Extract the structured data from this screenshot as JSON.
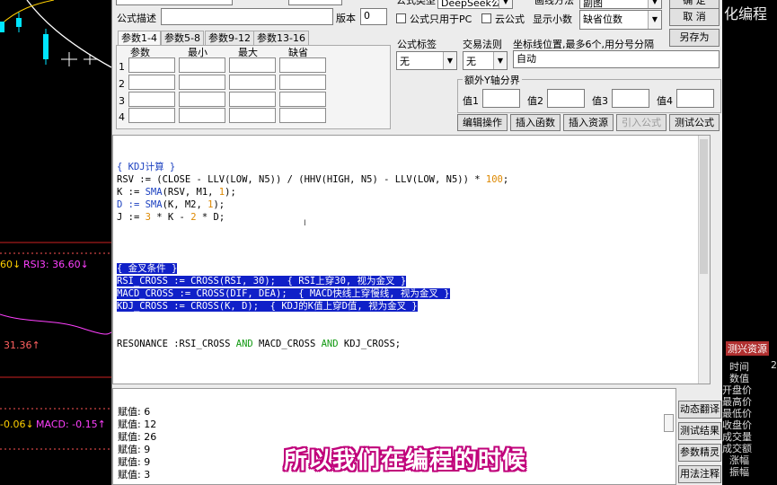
{
  "background_chart": {
    "rsi_label": "RSI3: 36.60↓",
    "rsi_left_value": "60↓",
    "mid_value": "31.36↑",
    "macd_label": "MACD: -0.15↑",
    "macd_left_value": "-0.06↓",
    "colors": {
      "candle_up": "#00e5ff",
      "ma_line": "#ffffff",
      "ma_line2": "#ffd000",
      "rsi_line": "#ff40ff",
      "dashed": "#ff3333"
    }
  },
  "dialog": {
    "top_row": {
      "formula_type_label": "公式类型",
      "formula_type_value": "DeepSeek公式",
      "draw_method_label": "画线方法",
      "draw_method_value": "副图",
      "confirm_button": "确 定"
    },
    "row2": {
      "desc_label": "公式描述",
      "desc_value": "",
      "version_label": "版本",
      "version_value": "0",
      "only_pc_label": "公式只用于PC",
      "cloud_label": "云公式",
      "decimals_label": "显示小数",
      "decimals_value": "缺省位数",
      "cancel_button": "取 消"
    },
    "save_as_button": "另存为",
    "param_tabs": [
      "参数1-4",
      "参数5-8",
      "参数9-12",
      "参数13-16"
    ],
    "param_headers": [
      "参数",
      "最小",
      "最大",
      "缺省"
    ],
    "param_rows": [
      "1",
      "2",
      "3",
      "4"
    ],
    "formula_tag_label": "公式标签",
    "formula_tag_value": "无",
    "trade_rule_label": "交易法则",
    "trade_rule_value": "无",
    "axis_label": "坐标线位置,最多6个,用分号分隔",
    "axis_value": "自动",
    "extra_y_group": "额外Y轴分界",
    "y_values": [
      "值1",
      "值2",
      "值3",
      "值4"
    ],
    "buttons": {
      "edit": "编辑操作",
      "insert_func": "插入函数",
      "insert_resource": "插入资源",
      "import_formula": "引入公式",
      "test_formula": "测试公式"
    }
  },
  "editor": {
    "lines": [
      {
        "segments": [
          {
            "t": "{ KDJ计算 }",
            "c": "cm"
          }
        ]
      },
      {
        "segments": [
          {
            "t": "RSV := (CLOSE - LLV(LOW, N5)) / (HHV(HIGH, N5) - LLV(LOW, N5)) * ",
            "c": ""
          },
          {
            "t": "100",
            "c": "num"
          },
          {
            "t": ";",
            "c": ""
          }
        ]
      },
      {
        "segments": [
          {
            "t": "K := ",
            "c": ""
          },
          {
            "t": "SMA",
            "c": "var"
          },
          {
            "t": "(RSV, M1, ",
            "c": ""
          },
          {
            "t": "1",
            "c": "num"
          },
          {
            "t": ");",
            "c": ""
          }
        ]
      },
      {
        "segments": [
          {
            "t": "D := ",
            "c": "var"
          },
          {
            "t": "SMA",
            "c": "var"
          },
          {
            "t": "(K, M2, ",
            "c": ""
          },
          {
            "t": "1",
            "c": "num"
          },
          {
            "t": ");",
            "c": ""
          }
        ]
      },
      {
        "segments": [
          {
            "t": "J := ",
            "c": ""
          },
          {
            "t": "3",
            "c": "num"
          },
          {
            "t": " * K - ",
            "c": ""
          },
          {
            "t": "2",
            "c": "num"
          },
          {
            "t": " * D;",
            "c": ""
          }
        ]
      },
      {
        "segments": [
          {
            "t": "{ 金叉条件 }",
            "c": "hl"
          }
        ]
      },
      {
        "segments": [
          {
            "t": "RSI_CROSS := CROSS(RSI, 30);  { RSI上穿30, 视为金叉 }",
            "c": "hl"
          }
        ]
      },
      {
        "segments": [
          {
            "t": "MACD_CROSS := CROSS(DIF, DEA);  { MACD快线上穿慢线, 视为金叉 }",
            "c": "hl"
          }
        ]
      },
      {
        "segments": [
          {
            "t": "KDJ_CROSS := CROSS(K, D);  { KDJ的K值上穿D值, 视为金叉 }",
            "c": "hl"
          }
        ]
      },
      {
        "segments": [
          {
            "t": "RESONANCE :RSI_CROSS ",
            "c": ""
          },
          {
            "t": "AND",
            "c": "kw"
          },
          {
            "t": " MACD_CROSS ",
            "c": ""
          },
          {
            "t": "AND",
            "c": "kw"
          },
          {
            "t": " KDJ_CROSS;",
            "c": ""
          }
        ]
      }
    ]
  },
  "output": {
    "lines": [
      "赋值: 6",
      "赋值: 12",
      "赋值: 26",
      "赋值: 9",
      "赋值: 9",
      "赋值: 3"
    ]
  },
  "output_buttons": [
    "动态翻译",
    "测试结果",
    "参数精灵",
    "用法注释"
  ],
  "right_strip": {
    "title_text": "化编程",
    "resource_label": "测兴资源",
    "items": [
      "时间",
      "数值",
      "开盘价",
      "最高价",
      "最低价",
      "收盘价",
      "成交量",
      "成交额",
      "涨幅",
      "振幅"
    ],
    "number": "2"
  },
  "subtitle": "所以我们在编程的时候"
}
